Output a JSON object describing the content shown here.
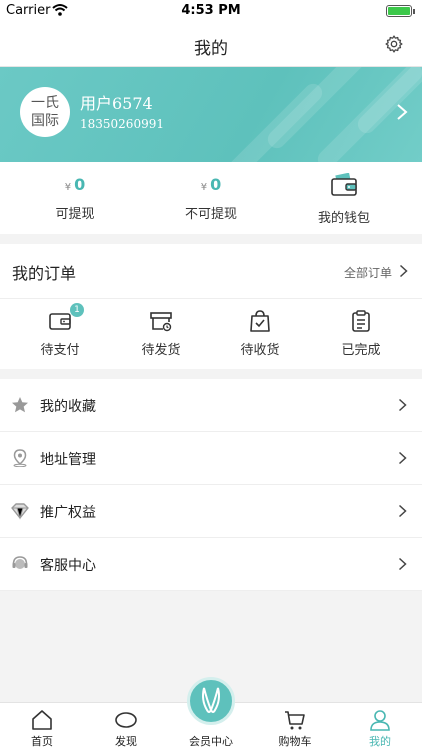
{
  "status_bar": {
    "carrier": "Carrier",
    "time": "4:53 PM"
  },
  "nav": {
    "title": "我的"
  },
  "profile": {
    "avatar_text_line1": "一氏",
    "avatar_text_line2": "国际",
    "username": "用户6574",
    "phone": "18350260991"
  },
  "balance": {
    "withdrawable": {
      "currency": "¥",
      "amount": "0",
      "label": "可提现"
    },
    "non_withdrawable": {
      "currency": "¥",
      "amount": "0",
      "label": "不可提现"
    },
    "wallet": {
      "label": "我的钱包"
    }
  },
  "orders": {
    "title": "我的订单",
    "all_label": "全部订单",
    "items": [
      {
        "label": "待支付",
        "badge": "1",
        "icon": "wallet-icon"
      },
      {
        "label": "待发货",
        "icon": "package-icon"
      },
      {
        "label": "待收货",
        "icon": "shopping-bag-icon"
      },
      {
        "label": "已完成",
        "icon": "clipboard-icon"
      }
    ]
  },
  "menu": [
    {
      "label": "我的收藏",
      "icon": "star-icon"
    },
    {
      "label": "地址管理",
      "icon": "location-pin-icon"
    },
    {
      "label": "推广权益",
      "icon": "diamond-icon"
    },
    {
      "label": "客服中心",
      "icon": "headset-icon"
    }
  ],
  "tabbar": {
    "tabs": [
      {
        "label": "首页",
        "icon": "home-icon"
      },
      {
        "label": "发现",
        "icon": "eye-icon"
      },
      {
        "label": "会员中心",
        "icon": "rabbit-icon"
      },
      {
        "label": "购物车",
        "icon": "cart-icon"
      },
      {
        "label": "我的",
        "icon": "user-icon",
        "active": true
      }
    ]
  },
  "colors": {
    "accent": "#5ec1bc",
    "accent_text": "#49b7b2"
  }
}
